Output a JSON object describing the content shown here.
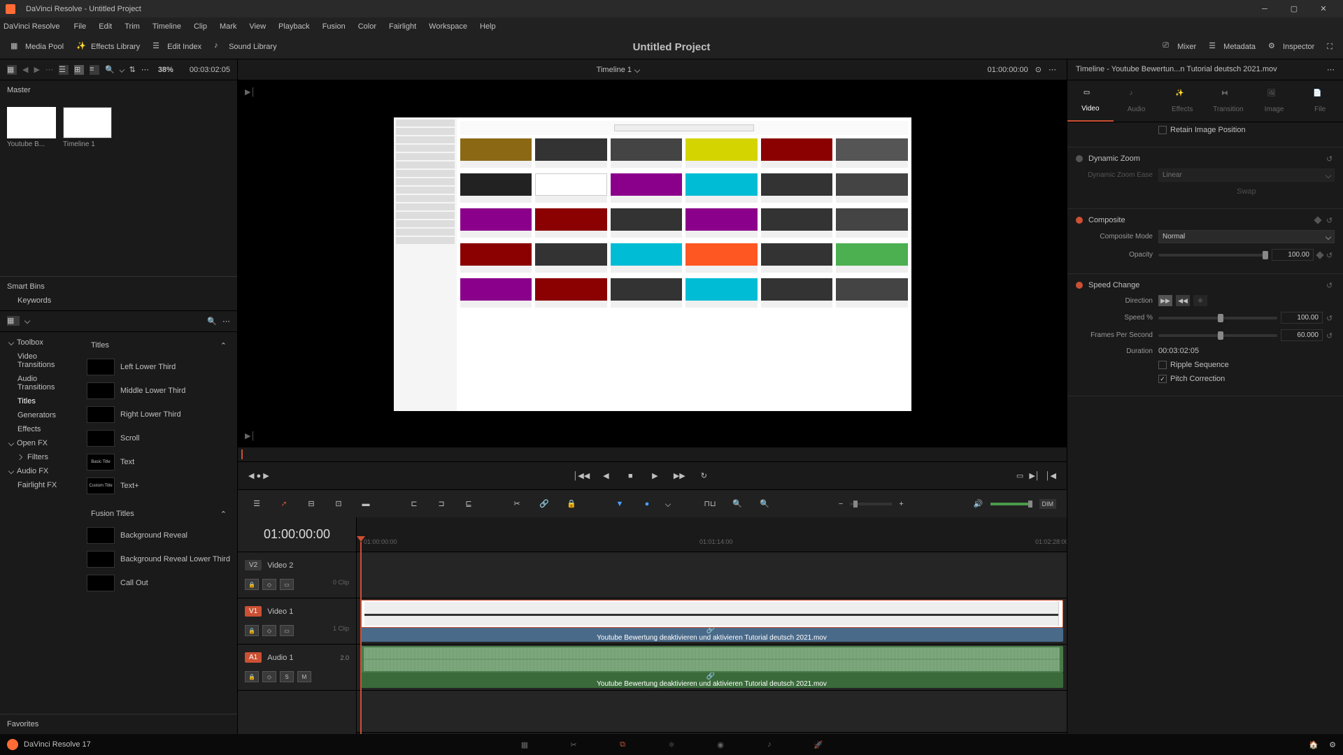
{
  "window": {
    "title": "DaVinci Resolve - Untitled Project",
    "app_name": "DaVinci Resolve"
  },
  "menubar": {
    "items": [
      "File",
      "Edit",
      "Trim",
      "Timeline",
      "Clip",
      "Mark",
      "View",
      "Playback",
      "Fusion",
      "Color",
      "Fairlight",
      "Workspace",
      "Help"
    ]
  },
  "toolbar": {
    "media_pool": "Media Pool",
    "effects_library": "Effects Library",
    "edit_index": "Edit Index",
    "sound_library": "Sound Library",
    "mixer": "Mixer",
    "metadata": "Metadata",
    "inspector": "Inspector",
    "project_title": "Untitled Project"
  },
  "media_pool": {
    "view_zoom": "38%",
    "duration": "00:03:02:05",
    "master": "Master",
    "smart_bins": "Smart Bins",
    "keywords": "Keywords",
    "favorites": "Favorites",
    "clips": [
      {
        "name": "Youtube B..."
      },
      {
        "name": "Timeline 1"
      }
    ]
  },
  "effects": {
    "search_placeholder": "Search",
    "categories": {
      "toolbox": "Toolbox",
      "video_transitions": "Video Transitions",
      "audio_transitions": "Audio Transitions",
      "titles": "Titles",
      "generators": "Generators",
      "effects": "Effects",
      "open_fx": "Open FX",
      "filters": "Filters",
      "audio_fx": "Audio FX",
      "fairlight_fx": "Fairlight FX"
    },
    "titles_header": "Titles",
    "fusion_titles_header": "Fusion Titles",
    "title_items": [
      "Left Lower Third",
      "Middle Lower Third",
      "Right Lower Third",
      "Scroll",
      "Text",
      "Text+"
    ],
    "fusion_title_items": [
      "Background Reveal",
      "Background Reveal Lower Third",
      "Call Out"
    ]
  },
  "viewer": {
    "timeline_name": "Timeline 1",
    "timecode": "01:00:00:00"
  },
  "timeline": {
    "timecode": "01:00:00:00",
    "ruler_ticks": [
      "01:00:00:00",
      "01:01:14:00",
      "01:02:28:00"
    ],
    "tracks": {
      "v2": {
        "badge": "V2",
        "name": "Video 2",
        "clips": "0 Clip"
      },
      "v1": {
        "badge": "V1",
        "name": "Video 1",
        "clips": "1 Clip"
      },
      "a1": {
        "badge": "A1",
        "name": "Audio 1",
        "channels": "2.0"
      }
    },
    "clip_name": "Youtube Bewertung deaktivieren und aktivieren Tutorial deutsch 2021.mov"
  },
  "inspector": {
    "header": "Timeline - Youtube Bewertun...n Tutorial deutsch 2021.mov",
    "tabs": {
      "video": "Video",
      "audio": "Audio",
      "effects": "Effects",
      "transition": "Transition",
      "image": "Image",
      "file": "File"
    },
    "retain_image_position": "Retain Image Position",
    "dynamic_zoom": {
      "title": "Dynamic Zoom",
      "ease_label": "Dynamic Zoom Ease",
      "ease_value": "Linear",
      "swap": "Swap"
    },
    "composite": {
      "title": "Composite",
      "mode_label": "Composite Mode",
      "mode_value": "Normal",
      "opacity_label": "Opacity",
      "opacity_value": "100.00"
    },
    "speed_change": {
      "title": "Speed Change",
      "direction_label": "Direction",
      "speed_label": "Speed %",
      "speed_value": "100.00",
      "fps_label": "Frames Per Second",
      "fps_value": "60.000",
      "duration_label": "Duration",
      "duration_value": "00:03:02:05",
      "ripple_sequence": "Ripple Sequence",
      "pitch_correction": "Pitch Correction"
    }
  },
  "bottom_nav": {
    "version": "DaVinci Resolve 17"
  }
}
